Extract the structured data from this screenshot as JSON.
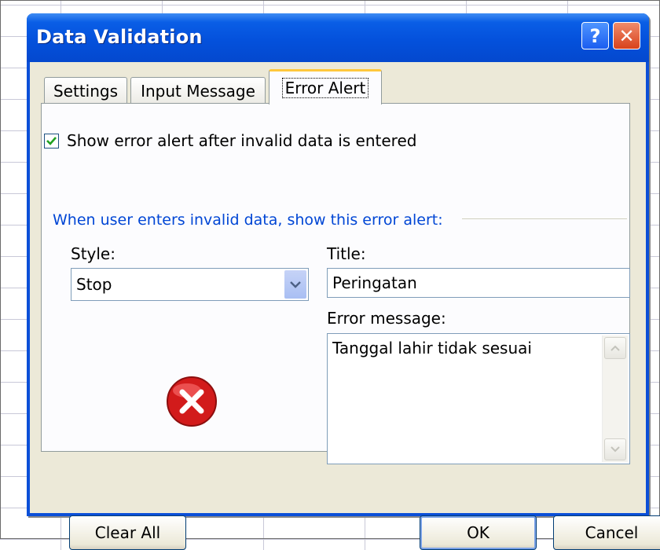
{
  "window": {
    "title": "Data Validation",
    "help_label": "?",
    "close_label": "✕"
  },
  "tabs": [
    {
      "label": "Settings"
    },
    {
      "label": "Input Message"
    },
    {
      "label": "Error Alert",
      "active": true
    }
  ],
  "error_alert": {
    "show_checkbox_label": "Show error alert after invalid data is entered",
    "show_checkbox_checked": true,
    "group_heading": "When user enters invalid data, show this error alert:",
    "style_label": "Style:",
    "style_value": "Stop",
    "title_label": "Title:",
    "title_value": "Peringatan",
    "message_label": "Error message:",
    "message_value": "Tanggal lahir tidak sesuai",
    "icon": "stop-error-icon"
  },
  "buttons": {
    "clear_all": "Clear All",
    "ok": "OK",
    "cancel": "Cancel"
  },
  "colors": {
    "title_bar": "#0451dc",
    "group_heading": "#0046d5",
    "active_tab_accent": "#ffc83c",
    "stop_icon": "#d21b1b"
  }
}
